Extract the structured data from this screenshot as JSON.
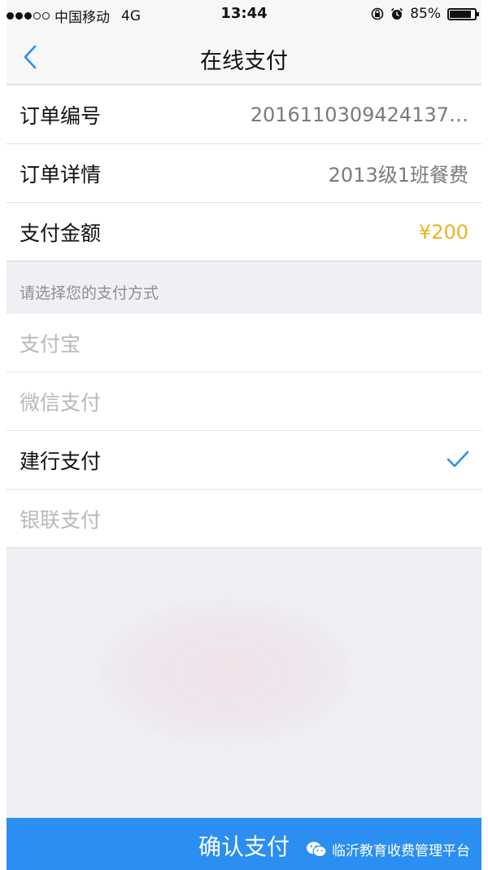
{
  "status_bar": {
    "carrier": "中国移动",
    "network": "4G",
    "time": "13:44",
    "battery": "85%"
  },
  "nav": {
    "title": "在线支付",
    "back_icon": "chevron-left-icon"
  },
  "order": {
    "rows": [
      {
        "label": "订单编号",
        "value": "2016110309424137…"
      },
      {
        "label": "订单详情",
        "value": "2013级1班餐费"
      },
      {
        "label": "支付金额",
        "value": "¥200"
      }
    ]
  },
  "payment": {
    "hint": "请选择您的支付方式",
    "methods": [
      {
        "label": "支付宝",
        "selected": false,
        "enabled": false
      },
      {
        "label": "微信支付",
        "selected": false,
        "enabled": false
      },
      {
        "label": "建行支付",
        "selected": true,
        "enabled": true
      },
      {
        "label": "银联支付",
        "selected": false,
        "enabled": false
      }
    ]
  },
  "footer": {
    "confirm_label": "确认支付",
    "watermark": "临沂教育收费管理平台"
  },
  "colors": {
    "accent": "#2a8ff0",
    "amount": "#e6b422",
    "check": "#2a8ff0"
  }
}
